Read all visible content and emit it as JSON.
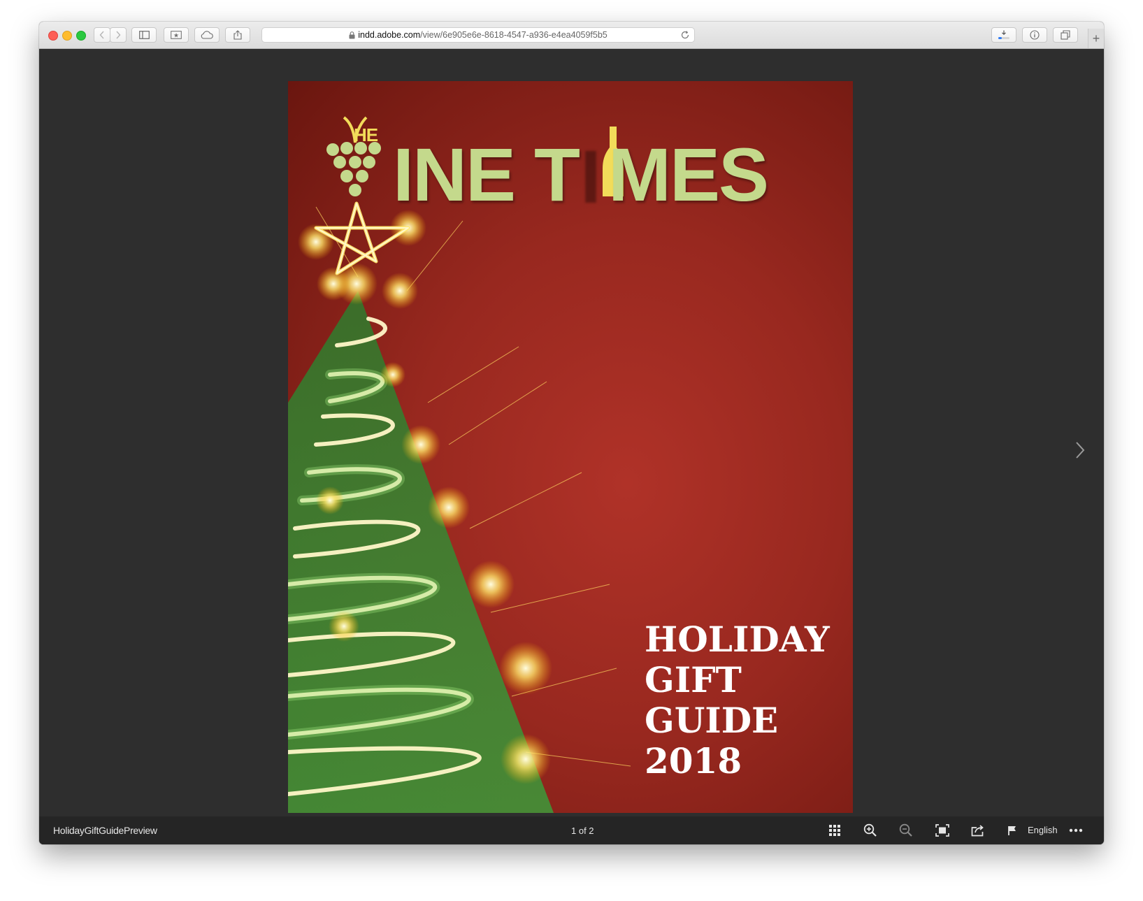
{
  "browser": {
    "url_host": "indd.adobe.com",
    "url_path": "/view/6e905e6e-8618-4547-a936-e4ea4059f5b5"
  },
  "cover": {
    "logo_the": "HE",
    "logo_main_1": "INE T",
    "logo_main_2": "MES",
    "title_lines": [
      "HOLIDAY",
      "GIFT",
      "GUIDE",
      "2018"
    ]
  },
  "footer": {
    "document_name": "HolidayGiftGuidePreview",
    "page_count": "1 of 2",
    "language": "English"
  },
  "icons": {
    "grid": "grid-icon",
    "zoom_in": "zoom-in-icon",
    "zoom_out": "zoom-out-icon",
    "fit": "fit-screen-icon",
    "share": "share-icon",
    "flag": "flag-icon",
    "more": "more-icon",
    "next": "chevron-right-icon"
  },
  "colors": {
    "cover_red": "#a72e25",
    "logo_green": "#c4d98c",
    "logo_yellow": "#f2dc5a",
    "viewer_bg": "#2e2e2e"
  }
}
